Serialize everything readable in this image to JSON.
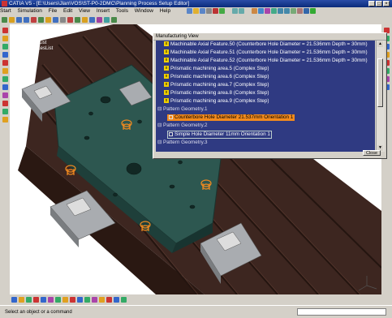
{
  "titlebar": {
    "text": "CATIA V5 - [E:\\Users\\Jlan\\VOS\\ST-P0-2DMC\\Planning Process Setup Editor]"
  },
  "menubar": {
    "items": [
      "Start",
      "Simulation",
      "File",
      "Edit",
      "View",
      "Insert",
      "Tools",
      "Window",
      "Help"
    ]
  },
  "tree": {
    "items": [
      "Process",
      "ProcessList",
      "ProductList",
      "ResourcesList"
    ]
  },
  "dialog": {
    "title": "Manufacturing View",
    "close_label": "Close",
    "rows": [
      "Machinable Axial Feature.50 (Counterbore Hole  Diameter = 21.536mm    Depth = 30mm)",
      "Machinable Axial Feature.51 (Counterbore Hole  Diameter = 21.536mm    Depth = 30mm)",
      "Machinable Axial Feature.52 (Counterbore Hole  Diameter = 21.536mm    Depth = 30mm)",
      "Prismatic machining area.5 (Complex Step)",
      "Prismatic machining area.6 (Complex Step)",
      "Prismatic machining area.7 (Complex Step)",
      "Prismatic machining area.8 (Complex Step)",
      "Prismatic machining area.9 (Complex Step)",
      "Pattern Geometry.1",
      "Counterbore Hole Diameter 21.537mm Orientation 1",
      "Pattern Geometry.2",
      "Simple Hole Diameter 11mm Orientation 1",
      "Pattern Geometry.3"
    ]
  },
  "status": {
    "message": "Select an object or a command"
  },
  "colors": {
    "dialog_list_bg": "#2f3a82",
    "selection": "#f28a1d",
    "feature_marker": "#f0d000",
    "fixture_plate": "#3d2620",
    "part": "#2d5750"
  }
}
